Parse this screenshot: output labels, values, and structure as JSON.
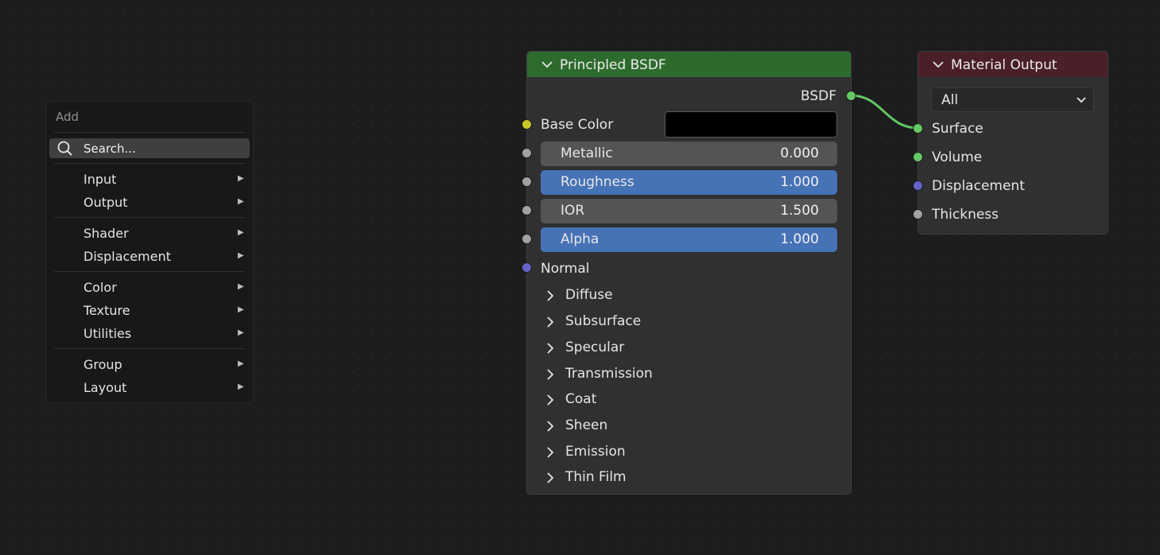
{
  "add_menu": {
    "title": "Add",
    "search_placeholder": "Search...",
    "groups": [
      [
        "Input",
        "Output"
      ],
      [
        "Shader",
        "Displacement"
      ],
      [
        "Color",
        "Texture",
        "Utilities"
      ],
      [
        "Group",
        "Layout"
      ]
    ]
  },
  "bsdf_node": {
    "title": "Principled BSDF",
    "output": "BSDF",
    "base_color_label": "Base Color",
    "base_color_value": "#000000",
    "inputs": [
      {
        "label": "Metallic",
        "value": "0.000",
        "style": "gray"
      },
      {
        "label": "Roughness",
        "value": "1.000",
        "style": "blue"
      },
      {
        "label": "IOR",
        "value": "1.500",
        "style": "gray"
      },
      {
        "label": "Alpha",
        "value": "1.000",
        "style": "blue"
      }
    ],
    "normal_label": "Normal",
    "panels": [
      "Diffuse",
      "Subsurface",
      "Specular",
      "Transmission",
      "Coat",
      "Sheen",
      "Emission",
      "Thin Film"
    ]
  },
  "output_node": {
    "title": "Material Output",
    "target": "All",
    "inputs": [
      "Surface",
      "Volume",
      "Displacement",
      "Thickness"
    ]
  },
  "colors": {
    "bsdf_header": "#2d6b2d",
    "output_header": "#4a1f28",
    "shader_socket": "#63c763",
    "color_socket": "#c7c729",
    "float_socket": "#a1a1a1",
    "vector_socket": "#6363c7",
    "link": "#63c763",
    "slider_blue": "#4672b6"
  },
  "icons": [
    "search-icon",
    "chevron-down-icon",
    "chevron-right-icon",
    "submenu-arrow-icon"
  ]
}
